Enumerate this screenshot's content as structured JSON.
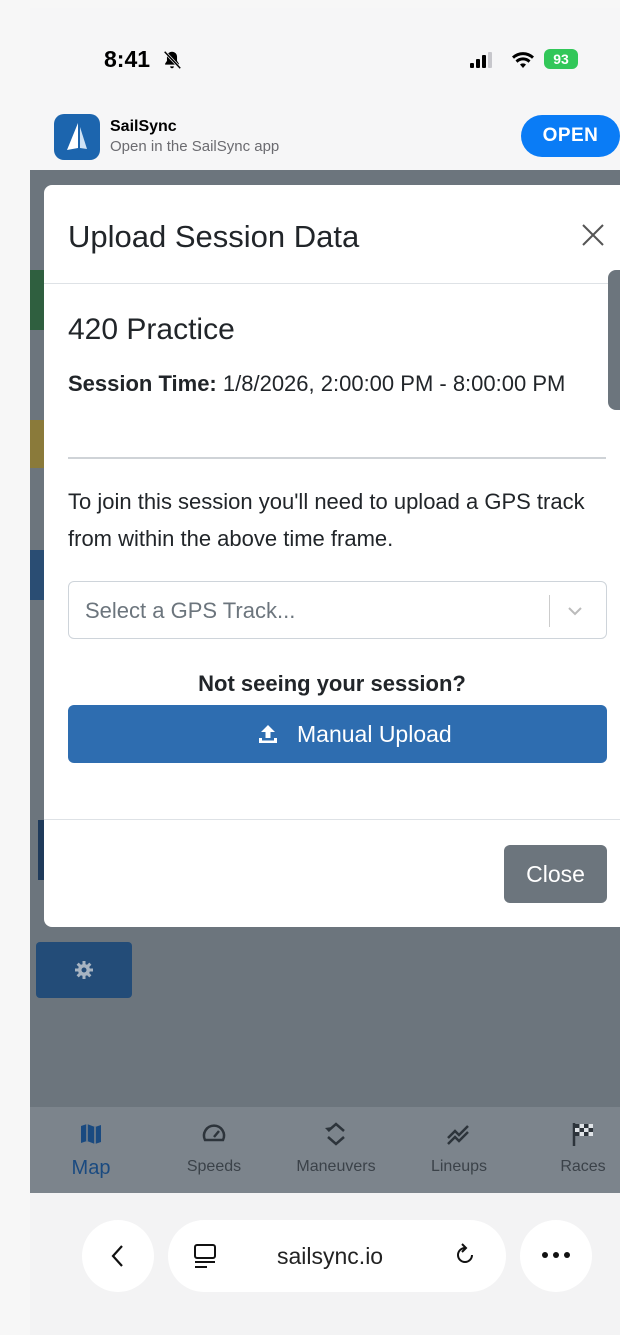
{
  "status_bar": {
    "time": "8:41",
    "battery": "93",
    "icons": [
      "bell-slash-icon",
      "signal-icon",
      "wifi-icon",
      "battery-icon"
    ]
  },
  "app_banner": {
    "name": "SailSync",
    "subtitle": "Open in the SailSync app",
    "open_label": "OPEN",
    "icon": "sailsync-logo"
  },
  "modal": {
    "title": "Upload Session Data",
    "session_name": "420 Practice",
    "session_time_label": "Session Time:",
    "session_time_value": "1/8/2026, 2:00:00 PM - 8:00:00 PM",
    "info_text": "To join this session you'll need to upload a GPS track from within the above time frame.",
    "select_placeholder": "Select a GPS Track...",
    "not_seeing": "Not seeing your session?",
    "manual_upload_label": "Manual Upload",
    "close_label": "Close"
  },
  "tabbar": {
    "tabs": [
      {
        "label": "Map",
        "icon": "map-icon",
        "active": true
      },
      {
        "label": "Speeds",
        "icon": "speedometer-icon",
        "active": false
      },
      {
        "label": "Maneuvers",
        "icon": "maneuvers-icon",
        "active": false
      },
      {
        "label": "Lineups",
        "icon": "lineups-icon",
        "active": false
      },
      {
        "label": "Races",
        "icon": "checkered-flag-icon",
        "active": false
      }
    ]
  },
  "browser": {
    "url": "sailsync.io"
  },
  "colors": {
    "primary": "#2e6db0",
    "secondary": "#6c757d",
    "ios_blue": "#0a7cf6",
    "battery_green": "#32c759"
  }
}
